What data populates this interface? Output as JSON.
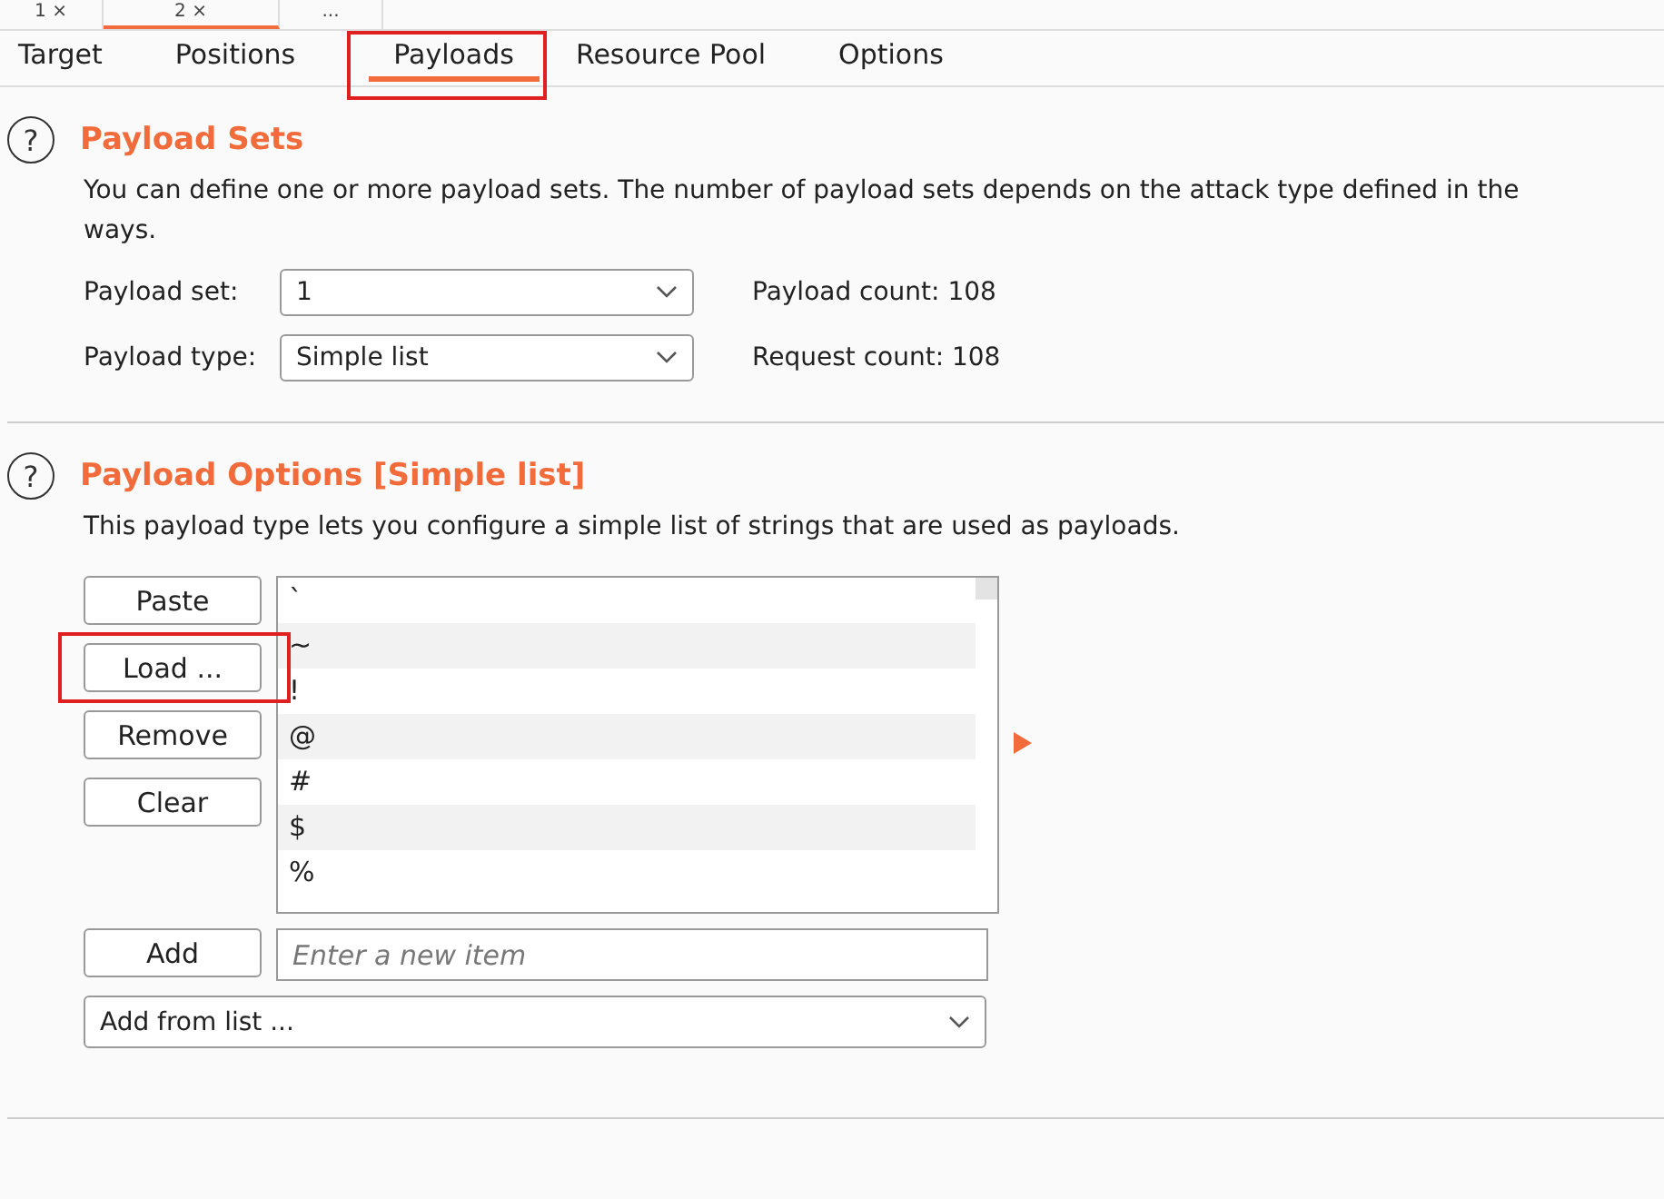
{
  "attack_tabs": [
    {
      "label": "1 ×",
      "selected": false
    },
    {
      "label": "2 ×",
      "selected": true
    },
    {
      "label": "...",
      "selected": false
    }
  ],
  "tabs": [
    {
      "label": "Target",
      "selected": false,
      "highlighted": false
    },
    {
      "label": "Positions",
      "selected": false,
      "highlighted": false
    },
    {
      "label": "Payloads",
      "selected": true,
      "highlighted": true
    },
    {
      "label": "Resource Pool",
      "selected": false,
      "highlighted": false
    },
    {
      "label": "Options",
      "selected": false,
      "highlighted": false
    }
  ],
  "payload_sets": {
    "help": "?",
    "title": "Payload Sets",
    "description_lines": [
      "You can define one or more payload sets. The number of payload sets depends on the attack type defined in the",
      "ways."
    ],
    "fields": [
      {
        "label": "Payload set:",
        "value": "1",
        "info": "Payload count: 108"
      },
      {
        "label": "Payload type:",
        "value": "Simple list",
        "info": "Request count: 108"
      }
    ]
  },
  "payload_options": {
    "help": "?",
    "title": "Payload Options [Simple list]",
    "description": "This payload type lets you configure a simple list of strings that are used as payloads.",
    "buttons": [
      {
        "label": "Paste",
        "highlighted": false
      },
      {
        "label": "Load ...",
        "highlighted": true
      },
      {
        "label": "Remove",
        "highlighted": false
      },
      {
        "label": "Clear",
        "highlighted": false
      }
    ],
    "items": [
      "`",
      "~",
      "!",
      "@",
      "#",
      "$",
      "%"
    ],
    "add_button": "Add",
    "new_item": {
      "placeholder": "Enter a new item"
    },
    "add_from_list": "Add from list ..."
  }
}
